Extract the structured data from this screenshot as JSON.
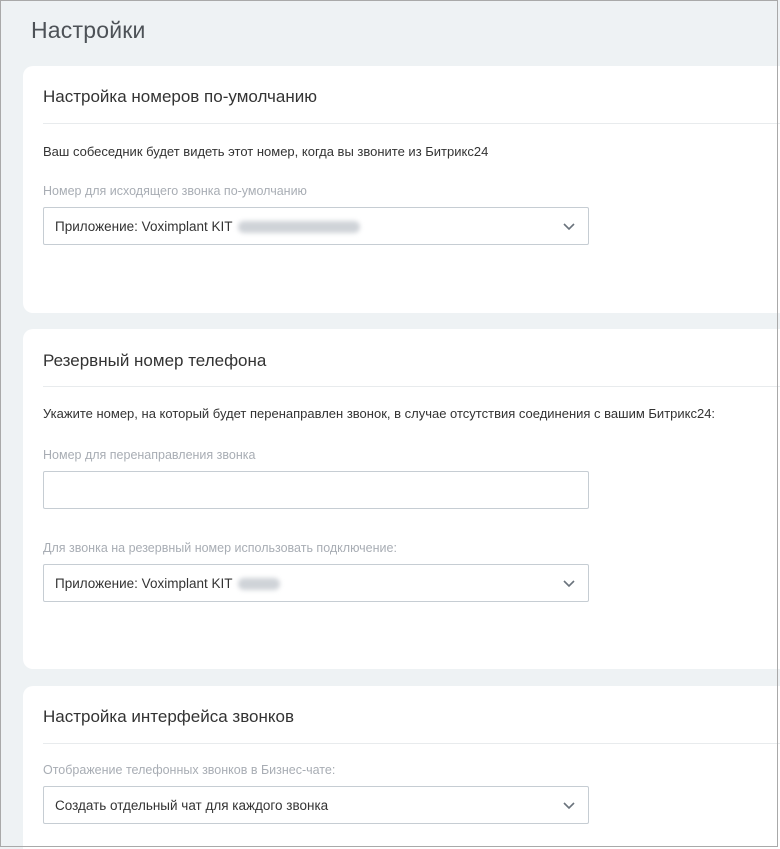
{
  "page": {
    "title": "Настройки"
  },
  "default_numbers": {
    "title": "Настройка номеров по-умолчанию",
    "description": "Ваш собеседник будет видеть этот номер, когда вы звоните из Битрикс24",
    "outgoing_label": "Номер для исходящего звонка по-умолчанию",
    "outgoing_value": "Приложение: Voximplant KIT"
  },
  "backup_number": {
    "title": "Резервный номер телефона",
    "description": "Укажите номер, на который будет перенаправлен звонок, в случае отсутствия соединения с вашим Битрикс24:",
    "redirect_label": "Номер для перенаправления звонка",
    "redirect_value": "",
    "connection_label": "Для звонка на резервный номер использовать подключение:",
    "connection_value": "Приложение: Voximplant KIT"
  },
  "call_interface": {
    "title": "Настройка интерфейса звонков",
    "display_label": "Отображение телефонных звонков в Бизнес-чате:",
    "display_value": "Создать отдельный чат для каждого звонка"
  },
  "icons": {
    "dropdown": "chevron-down-icon"
  },
  "colors": {
    "background": "#eef2f4",
    "card": "#ffffff",
    "label": "#a8adb4",
    "border": "#c6cdd3"
  }
}
